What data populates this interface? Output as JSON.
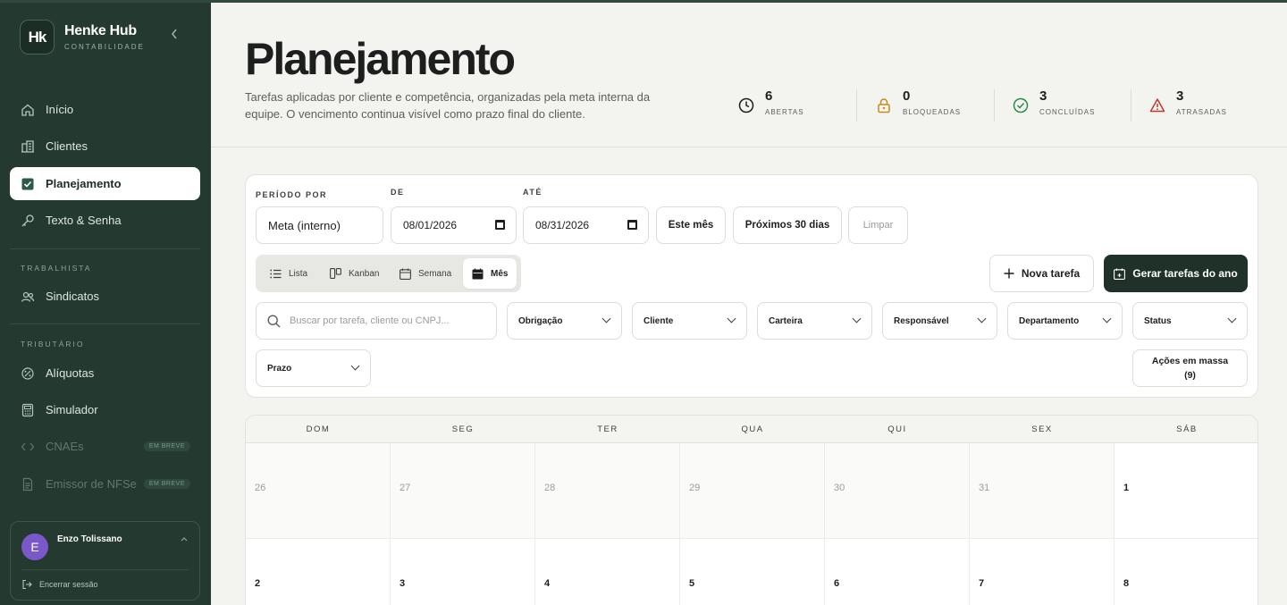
{
  "brand": {
    "logo": "Hk",
    "name": "Henke Hub",
    "subtitle": "CONTABILIDADE"
  },
  "sidebar": {
    "items": [
      {
        "label": "Início",
        "icon": "home-icon"
      },
      {
        "label": "Clientes",
        "icon": "building-icon"
      },
      {
        "label": "Planejamento",
        "icon": "checkbox-icon",
        "active": true
      },
      {
        "label": "Texto & Senha",
        "icon": "key-icon"
      }
    ],
    "sections": [
      {
        "label": "TRABALHISTA",
        "items": [
          {
            "label": "Sindicatos",
            "icon": "users-icon"
          }
        ]
      },
      {
        "label": "TRIBUTÁRIO",
        "items": [
          {
            "label": "Alíquotas",
            "icon": "percent-icon"
          },
          {
            "label": "Simulador",
            "icon": "calculator-icon"
          },
          {
            "label": "CNAEs",
            "icon": "code-icon",
            "badge": "EM BREVE"
          },
          {
            "label": "Emissor de NFSe",
            "icon": "file-icon",
            "badge": "EM BREVE"
          }
        ]
      }
    ]
  },
  "user": {
    "initial": "E",
    "name": "Enzo Tolissano",
    "logout": "Encerrar sessão"
  },
  "header": {
    "title": "Planejamento",
    "description": "Tarefas aplicadas por cliente e competência, organizadas pela meta interna da equipe. O vencimento continua visível como prazo final do cliente.",
    "stats": [
      {
        "value": "6",
        "label": "ABERTAS",
        "color": "#1c1f1d"
      },
      {
        "value": "0",
        "label": "BLOQUEADAS",
        "color": "#c98a1a"
      },
      {
        "value": "3",
        "label": "CONCLUÍDAS",
        "color": "#2e8b4a"
      },
      {
        "value": "3",
        "label": "ATRASADAS",
        "color": "#c0392b"
      }
    ]
  },
  "filters": {
    "period_label": "PERÍODO POR",
    "period_value": "Meta (interno)",
    "from_label": "DE",
    "from_value": "08/01/2026",
    "to_label": "ATÉ",
    "to_value": "08/31/2026",
    "this_month": "Este mês",
    "next_30": "Próximos 30 dias",
    "clear": "Limpar",
    "views": [
      "Lista",
      "Kanban",
      "Semana",
      "Mês"
    ],
    "active_view": "Mês",
    "new_task": "Nova tarefa",
    "generate": "Gerar tarefas do ano",
    "search_placeholder": "Buscar por tarefa, cliente ou CNPJ...",
    "selects": [
      "Obrigação",
      "Cliente",
      "Carteira",
      "Responsável",
      "Departamento",
      "Status"
    ],
    "deadline": "Prazo",
    "mass_actions": "Ações em massa",
    "mass_count": "(9)"
  },
  "calendar": {
    "weekdays": [
      "DOM",
      "SEG",
      "TER",
      "QUA",
      "QUI",
      "SEX",
      "SÁB"
    ],
    "days": [
      {
        "n": "26",
        "out": true
      },
      {
        "n": "27",
        "out": true
      },
      {
        "n": "28",
        "out": true
      },
      {
        "n": "29",
        "out": true
      },
      {
        "n": "30",
        "out": true
      },
      {
        "n": "31",
        "out": true
      },
      {
        "n": "1",
        "out": false
      },
      {
        "n": "2",
        "out": false
      },
      {
        "n": "3",
        "out": false
      },
      {
        "n": "4",
        "out": false
      },
      {
        "n": "5",
        "out": false
      },
      {
        "n": "6",
        "out": false
      },
      {
        "n": "7",
        "out": false
      },
      {
        "n": "8",
        "out": false
      }
    ]
  }
}
